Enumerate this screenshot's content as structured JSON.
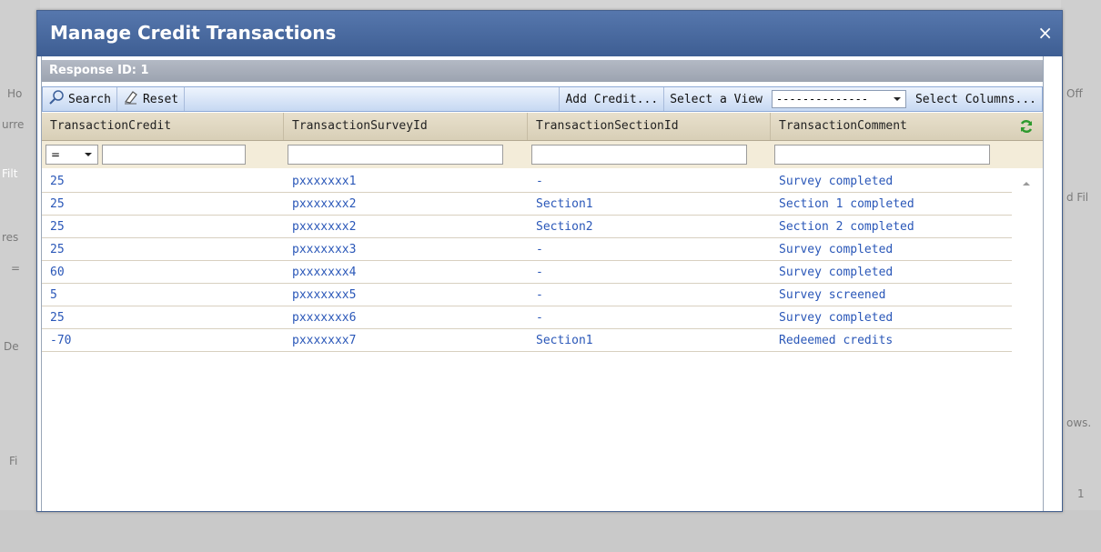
{
  "dialog": {
    "title": "Manage Credit Transactions",
    "close_label": "×",
    "response_label": "Response ID: 1"
  },
  "toolbar": {
    "search_label": "Search",
    "reset_label": "Reset",
    "add_credit_label": "Add Credit...",
    "select_view_label": "Select a View",
    "view_value": "--------------",
    "select_columns_label": "Select Columns..."
  },
  "grid": {
    "columns": [
      "TransactionCredit",
      "TransactionSurveyId",
      "TransactionSectionId",
      "TransactionComment"
    ],
    "filter_operator": "=",
    "rows": [
      {
        "credit": "25",
        "survey": "pxxxxxxx1",
        "section": "-",
        "comment": "Survey completed"
      },
      {
        "credit": "25",
        "survey": "pxxxxxxx2",
        "section": "Section1",
        "comment": "Section 1 completed"
      },
      {
        "credit": "25",
        "survey": "pxxxxxxx2",
        "section": "Section2",
        "comment": "Section 2 completed"
      },
      {
        "credit": "25",
        "survey": "pxxxxxxx3",
        "section": "-",
        "comment": "Survey completed"
      },
      {
        "credit": "60",
        "survey": "pxxxxxxx4",
        "section": "-",
        "comment": "Survey completed"
      },
      {
        "credit": "5",
        "survey": "pxxxxxxx5",
        "section": "-",
        "comment": "Survey screened"
      },
      {
        "credit": "25",
        "survey": "pxxxxxxx6",
        "section": "-",
        "comment": "Survey completed"
      },
      {
        "credit": "-70",
        "survey": "pxxxxxxx7",
        "section": "Section1",
        "comment": "Redeemed credits"
      }
    ]
  },
  "background": {
    "left_fragments": [
      "Ho",
      "urre",
      "Filt",
      "res",
      "=",
      "De",
      "Fi"
    ],
    "right_fragments": [
      "Off",
      "d Fil",
      "ows.",
      "1"
    ]
  },
  "colors": {
    "title_bar": "#4a6aa0",
    "link_text": "#2a57b8",
    "header_bar": "#a5acb8",
    "grid_header": "#ddd4bd"
  },
  "icons": [
    "search-icon",
    "eraser-icon",
    "refresh-icon",
    "chevron-down-icon",
    "scroll-up-icon",
    "close-icon"
  ]
}
